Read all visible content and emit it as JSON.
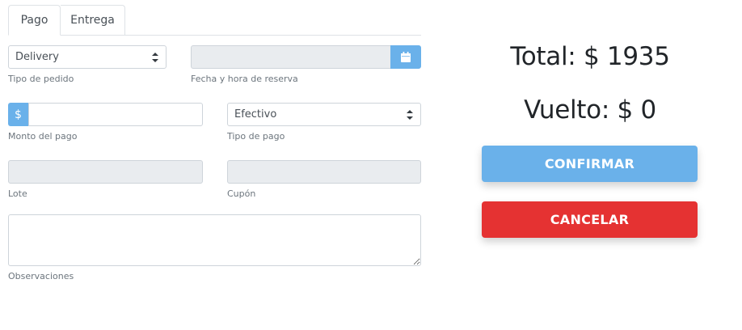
{
  "tabs": [
    {
      "label": "Pago",
      "active": true
    },
    {
      "label": "Entrega",
      "active": false
    }
  ],
  "form": {
    "tipo_pedido": {
      "value": "Delivery",
      "caption": "Tipo de pedido"
    },
    "fecha_reserva": {
      "value": "",
      "caption": "Fecha y hora de reserva",
      "icon": "calendar-icon"
    },
    "monto_pago": {
      "prefix": "$",
      "value": "",
      "caption": "Monto del pago"
    },
    "tipo_pago": {
      "value": "Efectivo",
      "caption": "Tipo de pago"
    },
    "lote": {
      "value": "",
      "caption": "Lote"
    },
    "cupon": {
      "value": "",
      "caption": "Cupón"
    },
    "observaciones": {
      "value": "",
      "caption": "Observaciones"
    }
  },
  "summary": {
    "total_text": "Total: $ 1935",
    "vuelto_text": "Vuelto: $ 0"
  },
  "actions": {
    "confirm_label": "CONFIRMAR",
    "cancel_label": "CANCELAR"
  },
  "colors": {
    "accent": "#6ab1ea",
    "danger": "#e53232",
    "disabled_bg": "#e9ecef"
  }
}
